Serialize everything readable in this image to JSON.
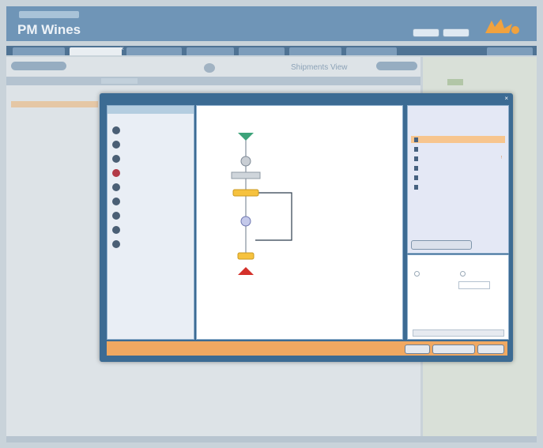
{
  "header": {
    "nav_label": "",
    "title": "PM Wines",
    "subtitle": "",
    "user_text": "",
    "btn1": "",
    "btn2": ""
  },
  "tabs": [
    {
      "label": ""
    },
    {
      "label": ""
    },
    {
      "label": ""
    },
    {
      "label": ""
    },
    {
      "label": ""
    },
    {
      "label": ""
    },
    {
      "label": ""
    },
    {
      "label": ""
    }
  ],
  "toolbar": {
    "left_btn": "",
    "panel_title": "Shipments View",
    "right_btn": ""
  },
  "filter": {
    "chip": ""
  },
  "left_list": [
    {
      "label": ""
    },
    {
      "label": ""
    },
    {
      "label": ""
    },
    {
      "label": ""
    },
    {
      "label": ""
    },
    {
      "label": ""
    },
    {
      "label": ""
    },
    {
      "label": ""
    },
    {
      "label": ""
    },
    {
      "label": ""
    },
    {
      "label": ""
    }
  ],
  "left_section": {
    "title": "",
    "desc_label": "",
    "desc_link": ""
  },
  "right_list": [
    {
      "label": ""
    },
    {
      "label": ""
    },
    {
      "label": ""
    }
  ],
  "dialog": {
    "title": "",
    "close": "×",
    "palette_title": "",
    "palette": [
      {
        "icon": "start-icon",
        "label": ""
      },
      {
        "icon": "end-icon",
        "label": ""
      },
      {
        "icon": "no-state-icon",
        "label": ""
      },
      {
        "icon": "stop-icon",
        "label": ""
      },
      {
        "icon": "workflow-icon",
        "label": ""
      },
      {
        "icon": "subworkflow-icon",
        "label": ""
      },
      {
        "icon": "user-icon",
        "label": ""
      },
      {
        "icon": "wait-icon",
        "label": ""
      },
      {
        "icon": "script-icon",
        "label": ""
      }
    ],
    "canvas": {
      "start_label": "",
      "state_label": "",
      "decision_label": "",
      "end_label": ""
    },
    "deps_title": "",
    "deps_subtitle": "",
    "dependencies": [
      {
        "label": "",
        "active": true,
        "warn": ""
      },
      {
        "label": "",
        "active": false,
        "warn": ""
      },
      {
        "label": "",
        "active": false,
        "warn": "!"
      },
      {
        "label": "",
        "active": false,
        "warn": ""
      },
      {
        "label": "",
        "active": false,
        "warn": ""
      },
      {
        "label": "",
        "active": false,
        "warn": ""
      }
    ],
    "add_button": "",
    "props_title": "",
    "radio1": "",
    "radio2": "",
    "field_label": "",
    "field_value": "",
    "footer": {
      "btn1": "",
      "btn2": "",
      "btn3": ""
    }
  },
  "colors": {
    "accent_orange": "#f0a861",
    "header_blue": "#6f95b7",
    "dialog_blue": "#3c6b93",
    "start_green": "#3da37a",
    "end_red": "#d4312b",
    "node_yellow": "#f6c23e"
  }
}
